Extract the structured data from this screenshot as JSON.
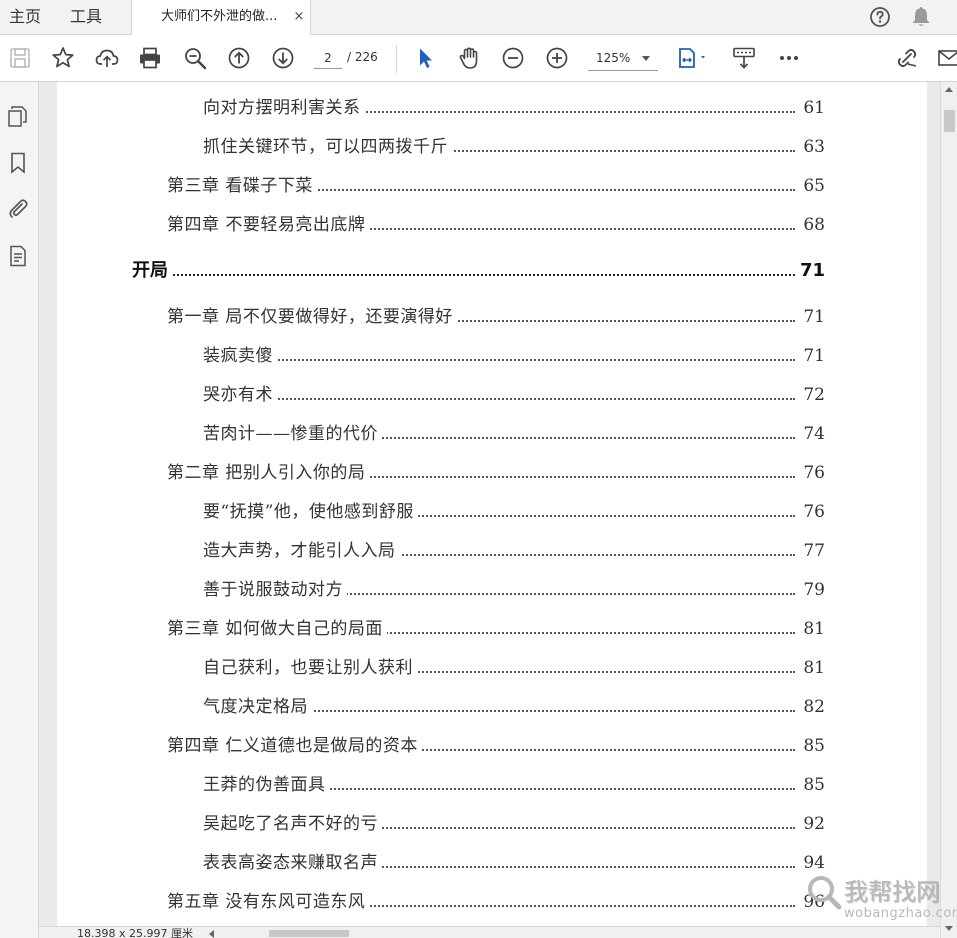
{
  "tabs": {
    "home": "主页",
    "tools": "工具",
    "document_title": "大师们不外泄的做...",
    "close_symbol": "×"
  },
  "toolbar": {
    "current_page": "2",
    "page_total": "/ 226",
    "zoom": "125%"
  },
  "icons": {
    "tabbar": [
      "help-icon",
      "bell-icon"
    ],
    "toolbar": [
      "save-icon",
      "bookmark-star-icon",
      "upload-cloud-icon",
      "print-icon",
      "zoom-out-search-icon",
      "page-up-icon",
      "page-down-icon",
      "select-pointer-icon",
      "hand-tool-icon",
      "zoom-minus-icon",
      "zoom-plus-icon",
      "fit-page-icon",
      "scroll-mode-icon",
      "more-icon",
      "sign-icon",
      "mail-icon"
    ],
    "left_pane": [
      "page-thumbnails-icon",
      "bookmarks-icon",
      "attachments-icon",
      "document-properties-icon"
    ]
  },
  "toc": [
    {
      "level": 2,
      "title": "向对方摆明利害关系",
      "page": "61"
    },
    {
      "level": 2,
      "title": "抓住关键环节，可以四两拨千斤",
      "page": "63"
    },
    {
      "level": 1,
      "title": "第三章  看碟子下菜",
      "page": "65"
    },
    {
      "level": 1,
      "title": "第四章  不要轻易亮出底牌",
      "page": "68"
    },
    {
      "level": 0,
      "title": "开局",
      "page": "71"
    },
    {
      "level": 1,
      "title": "第一章  局不仅要做得好，还要演得好",
      "page": "71"
    },
    {
      "level": 2,
      "title": "装疯卖傻",
      "page": "71"
    },
    {
      "level": 2,
      "title": "哭亦有术",
      "page": "72"
    },
    {
      "level": 2,
      "title": "苦肉计——惨重的代价",
      "page": "74"
    },
    {
      "level": 1,
      "title": "第二章  把别人引入你的局",
      "page": "76"
    },
    {
      "level": 2,
      "title": "要“抚摸”他，使他感到舒服",
      "page": "76"
    },
    {
      "level": 2,
      "title": "造大声势，才能引人入局",
      "page": "77"
    },
    {
      "level": 2,
      "title": "善于说服鼓动对方",
      "page": "79"
    },
    {
      "level": 1,
      "title": "第三章  如何做大自己的局面",
      "page": "81"
    },
    {
      "level": 2,
      "title": "自己获利，也要让别人获利",
      "page": "81"
    },
    {
      "level": 2,
      "title": "气度决定格局",
      "page": "82"
    },
    {
      "level": 1,
      "title": "第四章  仁义道德也是做局的资本",
      "page": "85"
    },
    {
      "level": 2,
      "title": "王莽的伪善面具",
      "page": "85"
    },
    {
      "level": 2,
      "title": "吴起吃了名声不好的亏",
      "page": "92"
    },
    {
      "level": 2,
      "title": "表表高姿态来赚取名声",
      "page": "94"
    },
    {
      "level": 1,
      "title": "第五章  没有东风可造东风",
      "page": "96"
    }
  ],
  "status": {
    "page_size": "18.398 x 25.997 厘米"
  },
  "watermark": {
    "text": "我帮找网",
    "url": "wobangzhao.com"
  },
  "colors": {
    "toolbar_bg": "#ffffff",
    "tabbar_bg": "#f2f2f2",
    "pointer_accent": "#1f5fbf",
    "page_bg": "#ffffff"
  }
}
